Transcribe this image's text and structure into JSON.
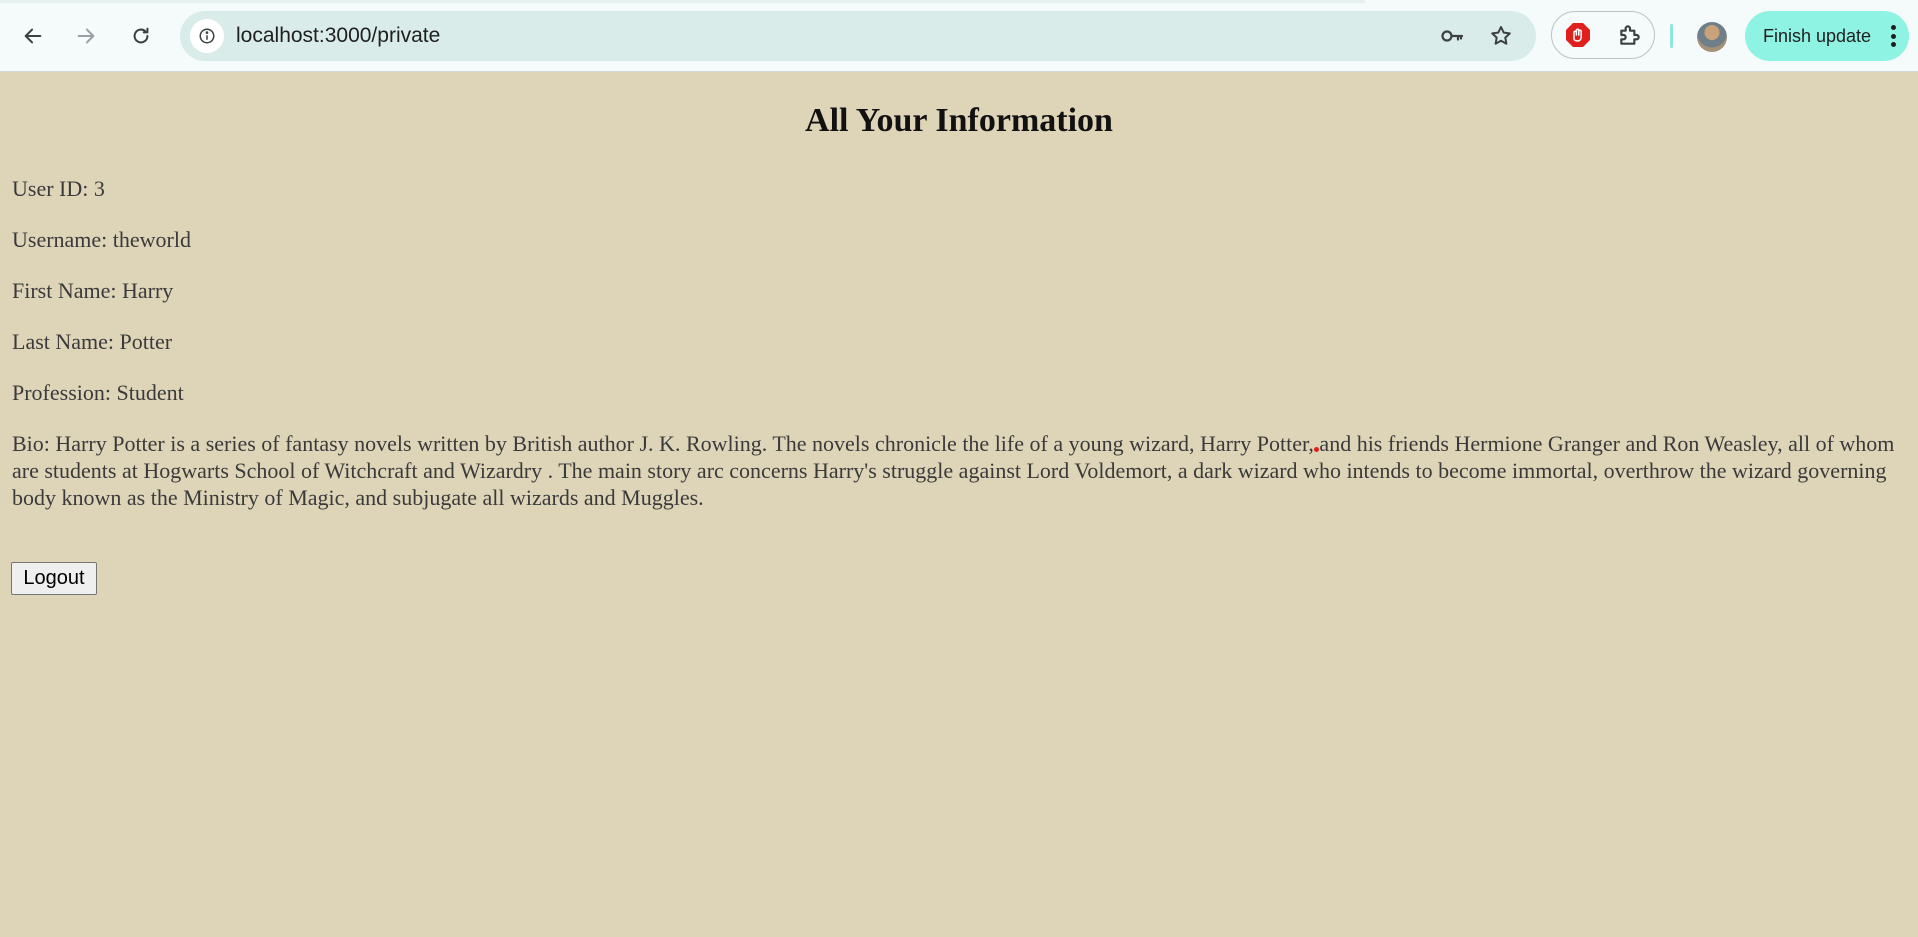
{
  "browser": {
    "url": "localhost:3000/private",
    "update_button_label": "Finish update",
    "icons": [
      "back-arrow-icon",
      "forward-arrow-icon",
      "reload-icon",
      "site-info-icon",
      "password-key-icon",
      "bookmark-star-icon",
      "adblock-stop-icon",
      "extensions-puzzle-icon",
      "profile-avatar",
      "more-vert-icon"
    ]
  },
  "page": {
    "heading": "All Your Information",
    "user_id": "User ID: 3",
    "username": "Username: theworld",
    "first_name": "First Name: Harry",
    "last_name": "Last Name: Potter",
    "profession": "Profession: Student",
    "bio": "Bio: Harry Potter is a series of fantasy novels written by British author J. K. Rowling. The novels chronicle the life of a young wizard, Harry Potter, and his friends Hermione Granger and Ron Weasley, all of whom are students at Hogwarts School of Witchcraft and Wizardry . The main story arc concerns Harry's struggle against Lord Voldemort, a dark wizard who intends to become immortal, overthrow the wizard governing body known as the Ministry of Magic, and subjugate all wizards and Muggles.",
    "logout_label": "Logout"
  },
  "colors": {
    "page_background": "#ded5b9",
    "toolbar_background": "#f4fbfa",
    "omnibox_background": "#d9ece9",
    "update_button": "#8ff3e3"
  }
}
